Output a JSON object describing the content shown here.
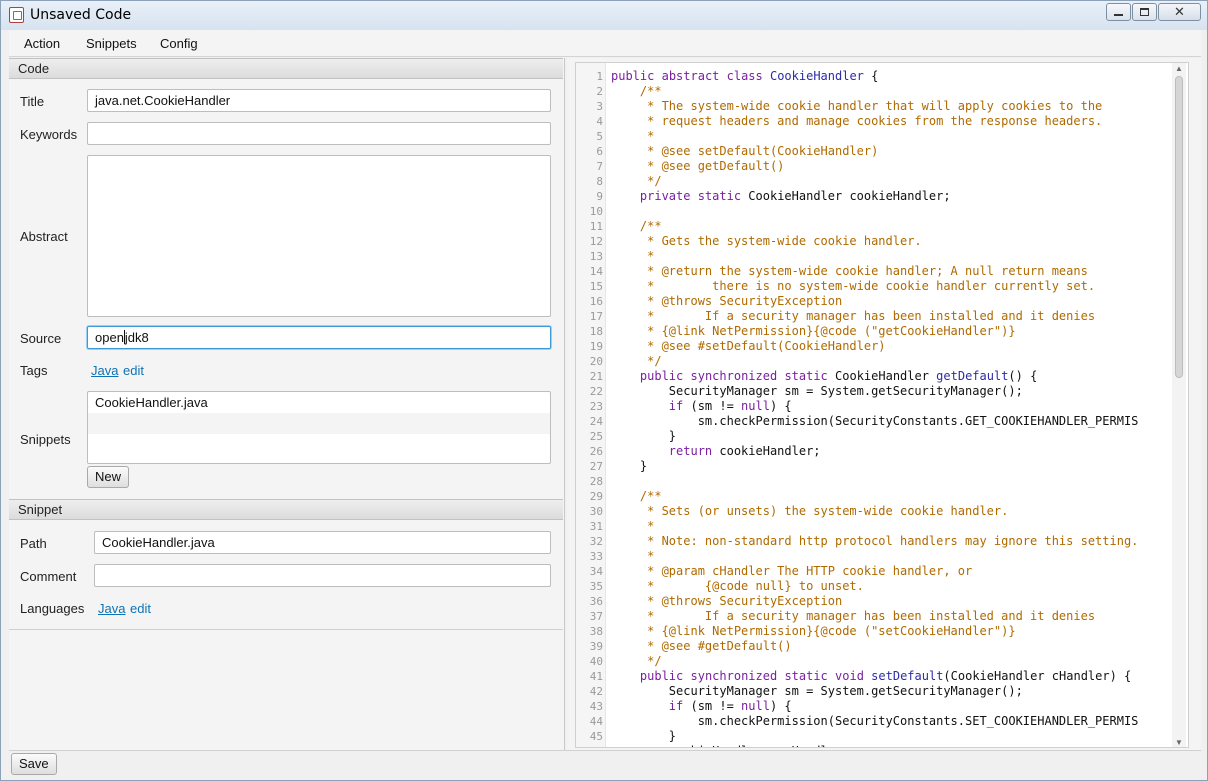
{
  "window": {
    "title": "Unsaved Code",
    "minimize_glyph": "",
    "maximize_glyph": "",
    "close_glyph": "✕"
  },
  "menu": {
    "items": [
      {
        "label": "Action"
      },
      {
        "label": "Snippets"
      },
      {
        "label": "Config"
      }
    ]
  },
  "code_section": {
    "header": "Code",
    "title_label": "Title",
    "title_value": "java.net.CookieHandler",
    "keywords_label": "Keywords",
    "keywords_value": "",
    "abstract_label": "Abstract",
    "abstract_value": "",
    "source_label": "Source",
    "source_value_before_caret": "open",
    "source_value_after_caret": "jdk8",
    "tags_label": "Tags",
    "tags_link": "Java",
    "tags_edit": "edit",
    "snippets_label": "Snippets",
    "snippets_list": [
      "CookieHandler.java",
      "",
      ""
    ],
    "new_button": "New"
  },
  "snippet_section": {
    "header": "Snippet",
    "path_label": "Path",
    "path_value": "CookieHandler.java",
    "comment_label": "Comment",
    "comment_value": "",
    "languages_label": "Languages",
    "languages_link": "Java",
    "languages_edit": "edit"
  },
  "bottom": {
    "save_button": "Save"
  },
  "editor": {
    "lines": [
      "public abstract class CookieHandler {",
      "    /**",
      "     * The system-wide cookie handler that will apply cookies to the",
      "     * request headers and manage cookies from the response headers.",
      "     *",
      "     * @see setDefault(CookieHandler)",
      "     * @see getDefault()",
      "     */",
      "    private static CookieHandler cookieHandler;",
      "",
      "    /**",
      "     * Gets the system-wide cookie handler.",
      "     *",
      "     * @return the system-wide cookie handler; A null return means",
      "     *        there is no system-wide cookie handler currently set.",
      "     * @throws SecurityException",
      "     *       If a security manager has been installed and it denies",
      "     * {@link NetPermission}{@code (\"getCookieHandler\")}",
      "     * @see #setDefault(CookieHandler)",
      "     */",
      "    public synchronized static CookieHandler getDefault() {",
      "        SecurityManager sm = System.getSecurityManager();",
      "        if (sm != null) {",
      "            sm.checkPermission(SecurityConstants.GET_COOKIEHANDLER_PERMIS",
      "        }",
      "        return cookieHandler;",
      "    }",
      "",
      "    /**",
      "     * Sets (or unsets) the system-wide cookie handler.",
      "     *",
      "     * Note: non-standard http protocol handlers may ignore this setting.",
      "     *",
      "     * @param cHandler The HTTP cookie handler, or",
      "     *       {@code null} to unset.",
      "     * @throws SecurityException",
      "     *       If a security manager has been installed and it denies",
      "     * {@link NetPermission}{@code (\"setCookieHandler\")}",
      "     * @see #getDefault()",
      "     */",
      "    public synchronized static void setDefault(CookieHandler cHandler) {",
      "        SecurityManager sm = System.getSecurityManager();",
      "        if (sm != null) {",
      "            sm.checkPermission(SecurityConstants.SET_COOKIEHANDLER_PERMIS",
      "        }",
      "        cookieHandler = cHandler;"
    ],
    "colors": {
      "keyword": "#7a1fa2",
      "class_name": "#2c2ca8",
      "comment": "#b06a00",
      "line_number": "#9a9a9a"
    }
  }
}
